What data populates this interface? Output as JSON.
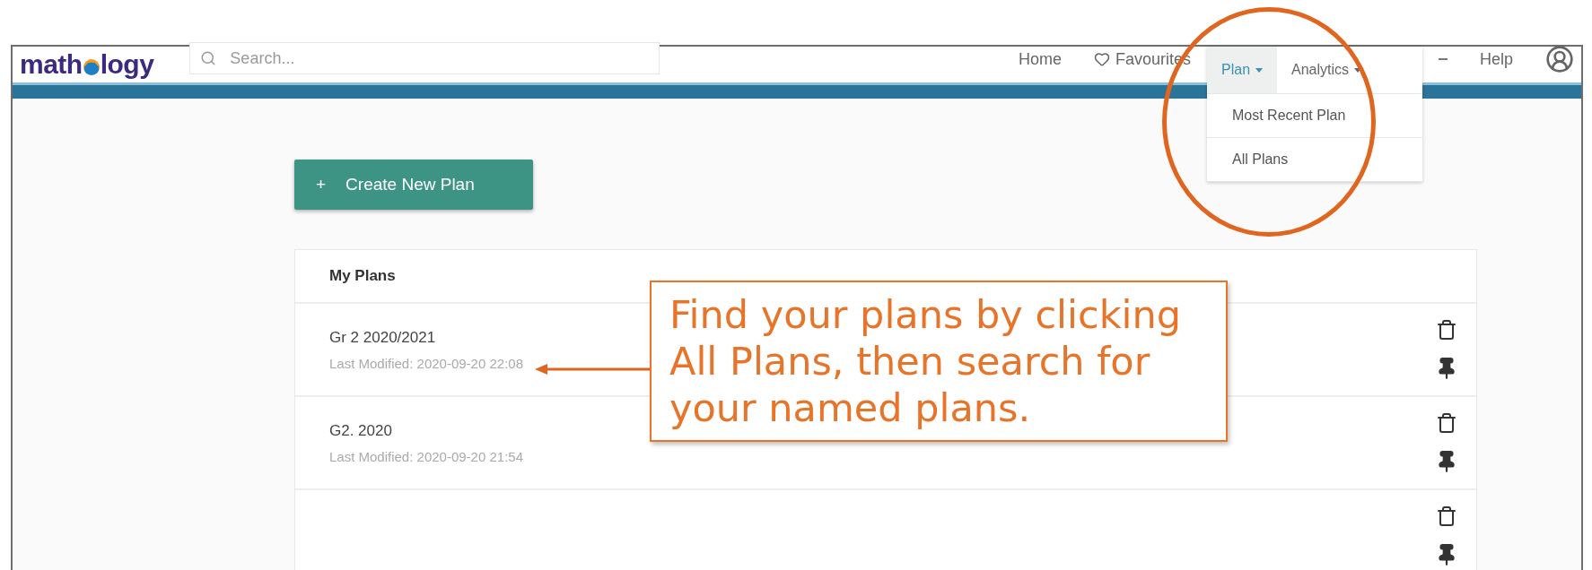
{
  "logo": {
    "text_before": "math",
    "text_after": "logy"
  },
  "search": {
    "placeholder": "Search..."
  },
  "nav": [
    {
      "kind": "link",
      "label": "Home"
    },
    {
      "kind": "icon-link",
      "label": "Favourites"
    },
    {
      "kind": "hidden-caret"
    },
    {
      "kind": "link",
      "label": "Help"
    },
    {
      "kind": "avatar"
    }
  ],
  "dropdown": {
    "tabs": [
      {
        "label": "Plan",
        "selected": true
      },
      {
        "label": "Analytics",
        "selected": false
      }
    ],
    "items": [
      "Most Recent Plan",
      "All Plans"
    ]
  },
  "create_button": {
    "icon": "+",
    "label": "Create New Plan"
  },
  "plans": {
    "title": "My Plans",
    "rows": [
      {
        "name": "Gr 2 2020/2021",
        "modified": "Last Modified: 2020-09-20 22:08"
      },
      {
        "name": "G2. 2020",
        "modified": "Last Modified: 2020-09-20 21:54"
      },
      {
        "name": "",
        "modified": ""
      }
    ]
  },
  "callout": {
    "text": "Find your plans by clicking All Plans, then search for your named plans."
  }
}
